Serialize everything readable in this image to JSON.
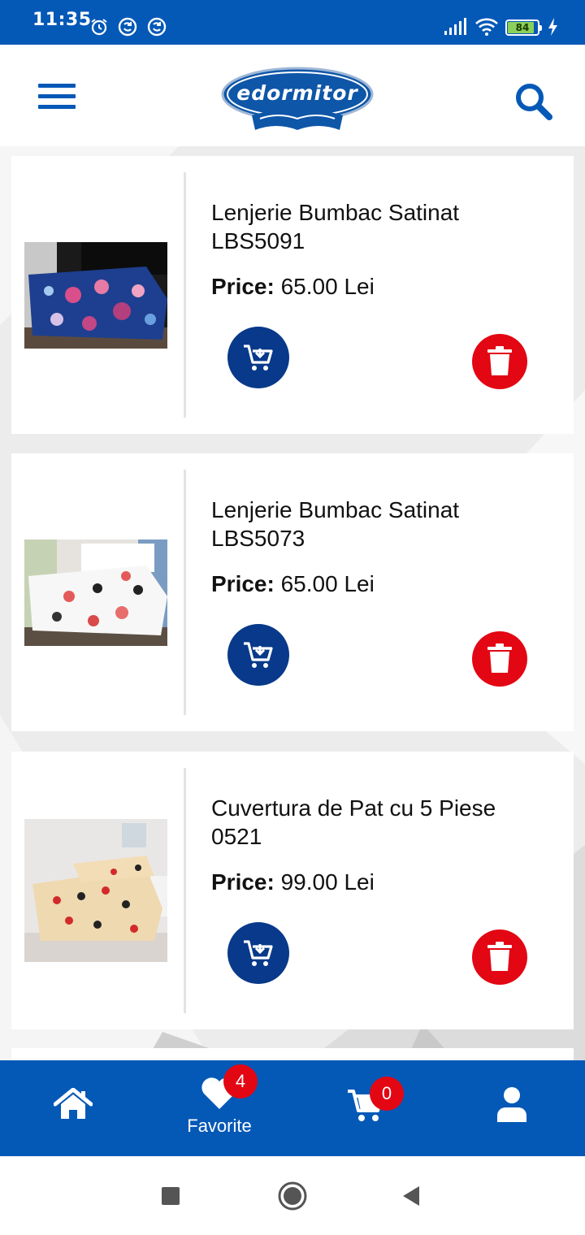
{
  "status_bar": {
    "time": "11:35",
    "icons": [
      "alarm-icon",
      "sync-icon",
      "sync-icon",
      "signal-icon",
      "wifi-icon"
    ],
    "battery": "84",
    "bg_color": "#0459b7"
  },
  "header": {
    "logo_text": "edormitor",
    "menu_icon": "hamburger-icon",
    "search_icon": "search-icon"
  },
  "favorites": [
    {
      "title": "Lenjerie Bumbac Satinat LBS5091",
      "price_label": "Price:",
      "price_value": "65.00 Lei",
      "image": "bedding-blue-floral",
      "add_to_cart_icon": "cart-download-icon",
      "delete_icon": "trash-icon"
    },
    {
      "title": "Lenjerie Bumbac Satinat LBS5073",
      "price_label": "Price:",
      "price_value": "65.00 Lei",
      "image": "bedding-white-floral",
      "add_to_cart_icon": "cart-download-icon",
      "delete_icon": "trash-icon"
    },
    {
      "title": "Cuvertura de Pat cu 5 Piese 0521",
      "price_label": "Price:",
      "price_value": "99.00 Lei",
      "image": "bedspread-beige-hearts",
      "add_to_cart_icon": "cart-download-icon",
      "delete_icon": "trash-icon"
    }
  ],
  "bottom_nav": {
    "home_icon": "home-icon",
    "favorites_label": "Favorite",
    "favorites_badge": "4",
    "cart_badge": "0",
    "account_icon": "user-icon"
  },
  "colors": {
    "brand_blue": "#0459b7",
    "button_blue": "#08398a",
    "delete_red": "#e30613"
  }
}
